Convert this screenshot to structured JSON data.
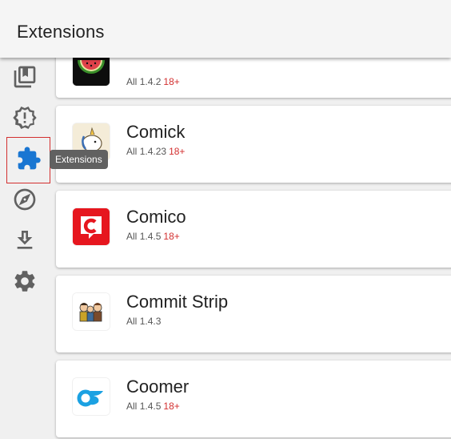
{
  "app": {
    "title": "Extensions"
  },
  "sidebar": {
    "items": [
      {
        "name": "library",
        "icon": "library-icon"
      },
      {
        "name": "updates",
        "icon": "alert-badge-icon"
      },
      {
        "name": "extensions",
        "icon": "puzzle-icon",
        "active": true
      },
      {
        "name": "browse",
        "icon": "compass-icon"
      },
      {
        "name": "downloads",
        "icon": "download-icon"
      },
      {
        "name": "settings",
        "icon": "gear-icon"
      }
    ],
    "tooltip": "Extensions"
  },
  "extensions": [
    {
      "name": "",
      "lang": "All",
      "version": "1.4.2",
      "age": "18+",
      "icon": "watermelon-icon"
    },
    {
      "name": "Comick",
      "lang": "All",
      "version": "1.4.23",
      "age": "18+",
      "icon": "comick-icon"
    },
    {
      "name": "Comico",
      "lang": "All",
      "version": "1.4.5",
      "age": "18+",
      "icon": "comico-icon"
    },
    {
      "name": "Commit Strip",
      "lang": "All",
      "version": "1.4.3",
      "age": "",
      "icon": "commit-strip-icon"
    },
    {
      "name": "Coomer",
      "lang": "All",
      "version": "1.4.5",
      "age": "18+",
      "icon": "coomer-icon"
    }
  ],
  "colors": {
    "accent": "#1976d2",
    "adult": "#d32f2f",
    "icon_gray": "#616161",
    "comico_red": "#e6161e",
    "coomer_blue": "#1ba1e2"
  }
}
